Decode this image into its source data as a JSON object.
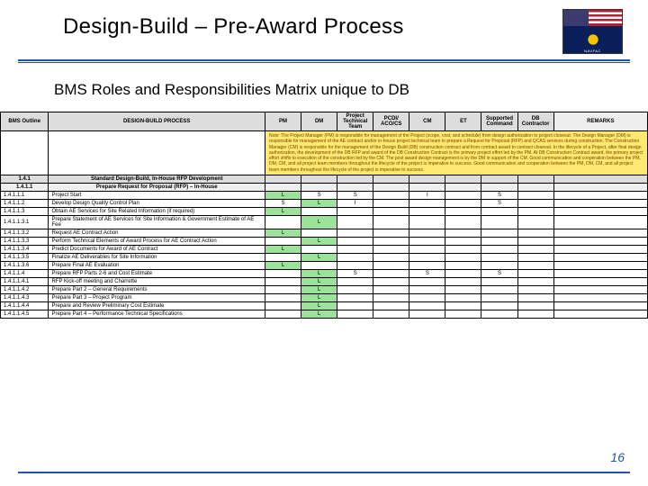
{
  "title": "Design-Build – Pre-Award Process",
  "subtitle": "BMS Roles and Responsibilities Matrix unique to DB",
  "logoText": "NAVFAC",
  "page": "16",
  "headers": {
    "outline": "BMS Outline",
    "process": "DESIGN-BUILD PROCESS",
    "pm": "PM",
    "dm": "DM",
    "ptt": "Project Technical Team",
    "pcdi": "PCDI/ ACO/CS",
    "cm": "CM",
    "et": "ET",
    "sc": "Supported Command",
    "dbc": "DB Contractor",
    "remarks": "REMARKS"
  },
  "note": "Note: The Project Manager (PM) is responsible for management of the Project (scope, cost, and schedule) from design authorization to project closeout. The Design Manager (DM) is responsible for management of the AE contract and/or in-house project technical team to prepare a Request for Proposal (RFP) and QCAS services during construction. The Construction Manager (CM) is responsible for the management of the Design Build (DB) construction contract and from contract award to contract closeout. In the lifecycle of a Project, after final design authorization, the development of the DB RFP and award of the DB Construction Contract is the primary project effort led by the PM. At DB Construction Contract award, the primary project effort shifts to execution of the construction led by the CM. The post award design management is by the DM in support of the CM. Good communication and cooperation between the PM, DM, CM, and all project team members throughout the lifecycle of the project is imperative to success. Good communication and cooperation between the PM, DM, CM, and all project team members throughout the lifecycle of the project is imperative to success.",
  "section": {
    "num": "1.4.1",
    "desc": "Standard Design-Build, In-House RFP Development"
  },
  "subsection": {
    "num": "1.4.1.1",
    "desc": "Prepare Request for Proposal (RFP) – In-House"
  },
  "rows": [
    {
      "n": "1.4.1.1.1",
      "d": "Project Start",
      "c": [
        "L",
        "S",
        "S",
        "",
        "I",
        "",
        "S",
        ""
      ]
    },
    {
      "n": "1.4.1.1.2",
      "d": "Develop Design Quality Control Plan",
      "c": [
        "S",
        "L",
        "I",
        "",
        "",
        "",
        "S",
        ""
      ]
    },
    {
      "n": "1.4.1.1.3",
      "d": "Obtain AE Services for Site Related Information (if required)",
      "c": [
        "L",
        "",
        "",
        "",
        "",
        "",
        "",
        ""
      ]
    },
    {
      "n": "1.4.1.1.3.1",
      "d": "Prepare Statement of AE Services for Site Information & Government Estimate of AE Fee",
      "c": [
        "",
        "L",
        "",
        "",
        "",
        "",
        "",
        ""
      ]
    },
    {
      "n": "1.4.1.1.3.2",
      "d": "Request AE Contract Action",
      "c": [
        "L",
        "",
        "",
        "",
        "",
        "",
        "",
        ""
      ]
    },
    {
      "n": "1.4.1.1.3.3",
      "d": "Perform Technical Elements of Award Process for AE Contract Action",
      "c": [
        "",
        "L",
        "",
        "",
        "",
        "",
        "",
        ""
      ]
    },
    {
      "n": "1.4.1.1.3.4",
      "d": "Predict Documents for Award of AE Contract",
      "c": [
        "L",
        "",
        "",
        "",
        "",
        "",
        "",
        ""
      ]
    },
    {
      "n": "1.4.1.1.3.5",
      "d": "Finalize AE Deliverables for Site Information",
      "c": [
        "",
        "L",
        "",
        "",
        "",
        "",
        "",
        ""
      ]
    },
    {
      "n": "1.4.1.1.3.6",
      "d": "Prepare Final AE Evaluation",
      "c": [
        "L",
        "",
        "",
        "",
        "",
        "",
        "",
        ""
      ]
    },
    {
      "n": "1.4.1.1.4",
      "d": "Prepare RFP Parts 2-6 and Cost Estimate",
      "c": [
        "",
        "L",
        "S",
        "",
        "S",
        "",
        "S",
        ""
      ]
    },
    {
      "n": "1.4.1.1.4.1",
      "d": "RFP Kick-off meeting and Charrette",
      "c": [
        "",
        "L",
        "",
        "",
        "",
        "",
        "",
        ""
      ]
    },
    {
      "n": "1.4.1.1.4.2",
      "d": "Prepare Part 2 – General Requirements",
      "c": [
        "",
        "L",
        "",
        "",
        "",
        "",
        "",
        ""
      ]
    },
    {
      "n": "1.4.1.1.4.3",
      "d": "Prepare Part 3 – Project Program",
      "c": [
        "",
        "L",
        "",
        "",
        "",
        "",
        "",
        ""
      ]
    },
    {
      "n": "1.4.1.1.4.4",
      "d": "Prepare and Review Preliminary Cost Estimate",
      "c": [
        "",
        "L",
        "",
        "",
        "",
        "",
        "",
        ""
      ]
    },
    {
      "n": "1.4.1.1.4.5",
      "d": "Prepare Part 4 – Performance Technical Specifications",
      "c": [
        "",
        "L",
        "",
        "",
        "",
        "",
        "",
        ""
      ]
    }
  ]
}
